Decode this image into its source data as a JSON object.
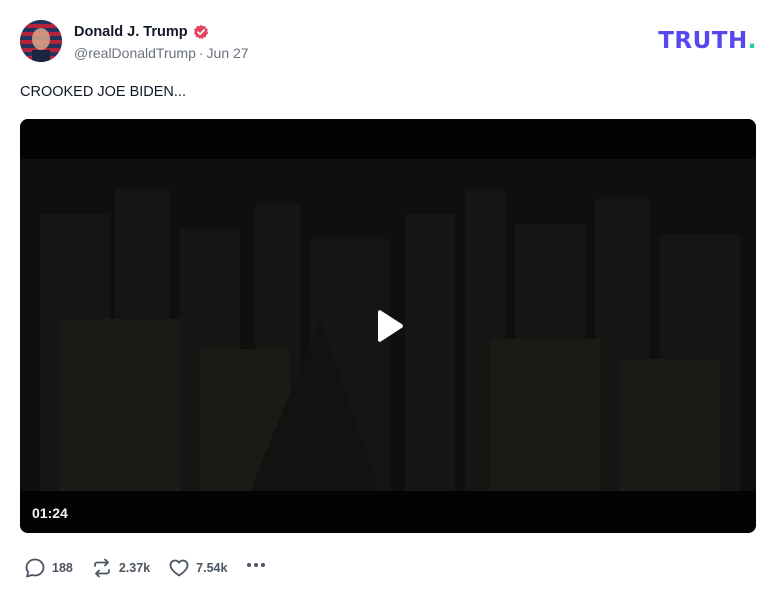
{
  "author": {
    "display_name": "Donald J. Trump",
    "handle": "@realDonaldTrump",
    "date": "Jun 27"
  },
  "brand": {
    "logo_text": "TRUTH",
    "logo_dot": ".",
    "accent_color": "#5448ee",
    "dot_color": "#1fd0a8"
  },
  "post": {
    "text": "CROOKED JOE BIDEN..."
  },
  "video": {
    "duration": "01:24"
  },
  "actions": {
    "replies": "188",
    "retruths": "2.37k",
    "likes": "7.54k"
  },
  "icons": {
    "reply": "speech-bubble-icon",
    "retruth": "repost-arrows-icon",
    "like": "heart-icon",
    "more": "ellipsis-icon",
    "verified": "verified-badge-icon",
    "play": "play-icon"
  }
}
